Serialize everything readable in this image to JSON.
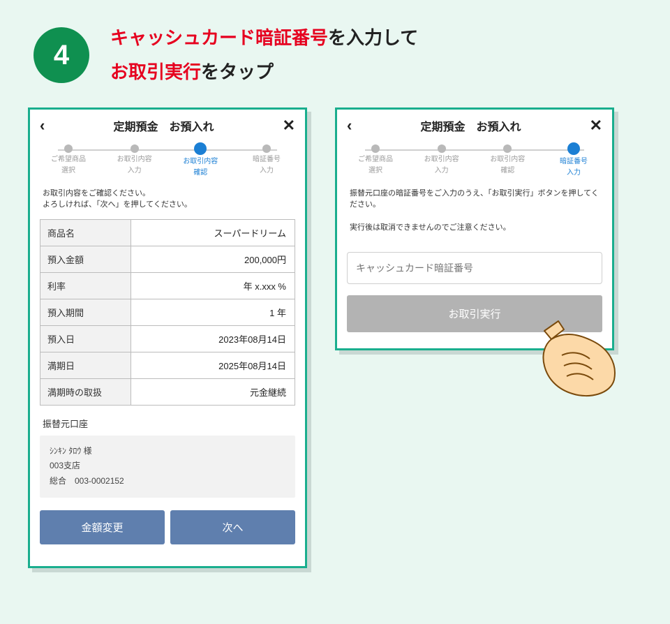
{
  "header": {
    "step_number": "4",
    "highlight1": "キャッシュカード暗証番号",
    "text1": "を入力して",
    "highlight2": "お取引実行",
    "text2": "をタップ"
  },
  "screen1": {
    "title": "定期預金　お預入れ",
    "steps": [
      {
        "l1": "ご希望商品",
        "l2": "選択"
      },
      {
        "l1": "お取引内容",
        "l2": "入力"
      },
      {
        "l1": "お取引内容",
        "l2": "確認"
      },
      {
        "l1": "暗証番号",
        "l2": "入力"
      }
    ],
    "active_step_index": 2,
    "helper": "お取引内容をご確認ください。\nよろしければ、「次へ」を押してください。",
    "table": [
      {
        "label": "商品名",
        "value": "スーパードリーム"
      },
      {
        "label": "預入金額",
        "value": "200,000円"
      },
      {
        "label": "利率",
        "value": "年 x.xxx %"
      },
      {
        "label": "預入期間",
        "value": "1 年"
      },
      {
        "label": "預入日",
        "value": "2023年08月14日"
      },
      {
        "label": "満期日",
        "value": "2025年08月14日"
      },
      {
        "label": "満期時の取扱",
        "value": "元金継続"
      }
    ],
    "transfer_label": "振替元口座",
    "account": {
      "name": "ｼﾝｷﾝ ﾀﾛｳ 様",
      "branch": "003支店",
      "kind": "総合　003-0002152"
    },
    "btn_change": "金額変更",
    "btn_next": "次へ"
  },
  "screen2": {
    "title": "定期預金　お預入れ",
    "steps": [
      {
        "l1": "ご希望商品",
        "l2": "選択"
      },
      {
        "l1": "お取引内容",
        "l2": "入力"
      },
      {
        "l1": "お取引内容",
        "l2": "確認"
      },
      {
        "l1": "暗証番号",
        "l2": "入力"
      }
    ],
    "active_step_index": 3,
    "helper": "振替元口座の暗証番号をご入力のうえ、「お取引実行」ボタンを押してください。\n\n実行後は取消できませんのでご注意ください。",
    "pin_placeholder": "キャッシュカード暗証番号",
    "btn_exec": "お取引実行"
  }
}
